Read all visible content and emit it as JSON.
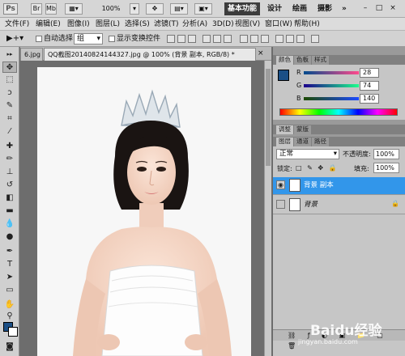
{
  "appbar": {
    "logo": "Ps",
    "zoom": "100%",
    "workspaces": [
      "基本功能",
      "设计",
      "绘画",
      "摄影"
    ],
    "more": "»",
    "window_controls": [
      "–",
      "□",
      "×"
    ]
  },
  "menu": [
    "文件(F)",
    "编辑(E)",
    "图像(I)",
    "图层(L)",
    "选择(S)",
    "滤镜(T)",
    "分析(A)",
    "3D(D)",
    "视图(V)",
    "窗口(W)",
    "帮助(H)"
  ],
  "options": {
    "auto_select_label": "自动选择:",
    "auto_select_value": "组",
    "show_transform_label": "显示变换控件"
  },
  "doc_tabs": [
    {
      "label": "6.jpg"
    },
    {
      "label": "QQ截图20140824144327.jpg @ 100% (背景 副本, RGB/8) *",
      "active": true
    }
  ],
  "color_panel": {
    "tabs": [
      "颜色",
      "色板",
      "样式"
    ],
    "r_label": "R",
    "r_value": "28",
    "g_label": "G",
    "g_value": "74",
    "b_label": "B",
    "b_value": "140",
    "foreground": "#1b4f86"
  },
  "adjust_panel": {
    "tabs": [
      "调整",
      "蒙版"
    ]
  },
  "layers_panel": {
    "tabs": [
      "图层",
      "通道",
      "路径"
    ],
    "blend_mode": "正常",
    "opacity_label": "不透明度:",
    "opacity_value": "100%",
    "lock_label": "锁定:",
    "fill_label": "填充:",
    "fill_value": "100%",
    "layers": [
      {
        "name": "背景 副本",
        "selected": true
      },
      {
        "name": "背景",
        "selected": false
      }
    ]
  },
  "watermark": {
    "logo_text": "Baidu经验",
    "url": "jingyan.baidu.com"
  }
}
